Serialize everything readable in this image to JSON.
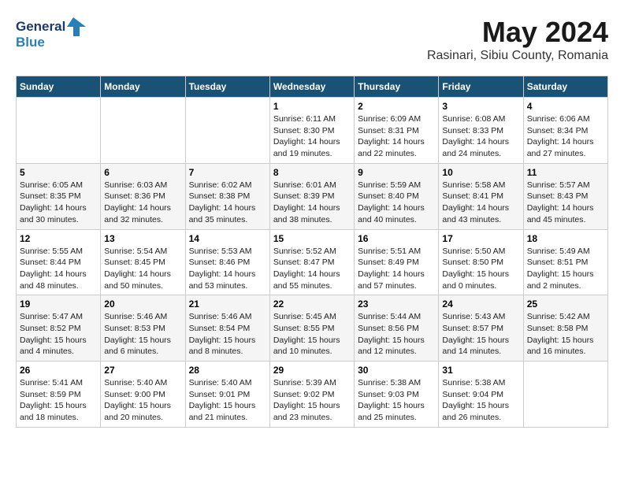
{
  "app": {
    "name": "GeneralBlue",
    "title": "May 2024",
    "subtitle": "Rasinari, Sibiu County, Romania"
  },
  "calendar": {
    "headers": [
      "Sunday",
      "Monday",
      "Tuesday",
      "Wednesday",
      "Thursday",
      "Friday",
      "Saturday"
    ],
    "weeks": [
      [
        {
          "day": "",
          "info": ""
        },
        {
          "day": "",
          "info": ""
        },
        {
          "day": "",
          "info": ""
        },
        {
          "day": "1",
          "info": "Sunrise: 6:11 AM\nSunset: 8:30 PM\nDaylight: 14 hours\nand 19 minutes."
        },
        {
          "day": "2",
          "info": "Sunrise: 6:09 AM\nSunset: 8:31 PM\nDaylight: 14 hours\nand 22 minutes."
        },
        {
          "day": "3",
          "info": "Sunrise: 6:08 AM\nSunset: 8:33 PM\nDaylight: 14 hours\nand 24 minutes."
        },
        {
          "day": "4",
          "info": "Sunrise: 6:06 AM\nSunset: 8:34 PM\nDaylight: 14 hours\nand 27 minutes."
        }
      ],
      [
        {
          "day": "5",
          "info": "Sunrise: 6:05 AM\nSunset: 8:35 PM\nDaylight: 14 hours\nand 30 minutes."
        },
        {
          "day": "6",
          "info": "Sunrise: 6:03 AM\nSunset: 8:36 PM\nDaylight: 14 hours\nand 32 minutes."
        },
        {
          "day": "7",
          "info": "Sunrise: 6:02 AM\nSunset: 8:38 PM\nDaylight: 14 hours\nand 35 minutes."
        },
        {
          "day": "8",
          "info": "Sunrise: 6:01 AM\nSunset: 8:39 PM\nDaylight: 14 hours\nand 38 minutes."
        },
        {
          "day": "9",
          "info": "Sunrise: 5:59 AM\nSunset: 8:40 PM\nDaylight: 14 hours\nand 40 minutes."
        },
        {
          "day": "10",
          "info": "Sunrise: 5:58 AM\nSunset: 8:41 PM\nDaylight: 14 hours\nand 43 minutes."
        },
        {
          "day": "11",
          "info": "Sunrise: 5:57 AM\nSunset: 8:43 PM\nDaylight: 14 hours\nand 45 minutes."
        }
      ],
      [
        {
          "day": "12",
          "info": "Sunrise: 5:55 AM\nSunset: 8:44 PM\nDaylight: 14 hours\nand 48 minutes."
        },
        {
          "day": "13",
          "info": "Sunrise: 5:54 AM\nSunset: 8:45 PM\nDaylight: 14 hours\nand 50 minutes."
        },
        {
          "day": "14",
          "info": "Sunrise: 5:53 AM\nSunset: 8:46 PM\nDaylight: 14 hours\nand 53 minutes."
        },
        {
          "day": "15",
          "info": "Sunrise: 5:52 AM\nSunset: 8:47 PM\nDaylight: 14 hours\nand 55 minutes."
        },
        {
          "day": "16",
          "info": "Sunrise: 5:51 AM\nSunset: 8:49 PM\nDaylight: 14 hours\nand 57 minutes."
        },
        {
          "day": "17",
          "info": "Sunrise: 5:50 AM\nSunset: 8:50 PM\nDaylight: 15 hours\nand 0 minutes."
        },
        {
          "day": "18",
          "info": "Sunrise: 5:49 AM\nSunset: 8:51 PM\nDaylight: 15 hours\nand 2 minutes."
        }
      ],
      [
        {
          "day": "19",
          "info": "Sunrise: 5:47 AM\nSunset: 8:52 PM\nDaylight: 15 hours\nand 4 minutes."
        },
        {
          "day": "20",
          "info": "Sunrise: 5:46 AM\nSunset: 8:53 PM\nDaylight: 15 hours\nand 6 minutes."
        },
        {
          "day": "21",
          "info": "Sunrise: 5:46 AM\nSunset: 8:54 PM\nDaylight: 15 hours\nand 8 minutes."
        },
        {
          "day": "22",
          "info": "Sunrise: 5:45 AM\nSunset: 8:55 PM\nDaylight: 15 hours\nand 10 minutes."
        },
        {
          "day": "23",
          "info": "Sunrise: 5:44 AM\nSunset: 8:56 PM\nDaylight: 15 hours\nand 12 minutes."
        },
        {
          "day": "24",
          "info": "Sunrise: 5:43 AM\nSunset: 8:57 PM\nDaylight: 15 hours\nand 14 minutes."
        },
        {
          "day": "25",
          "info": "Sunrise: 5:42 AM\nSunset: 8:58 PM\nDaylight: 15 hours\nand 16 minutes."
        }
      ],
      [
        {
          "day": "26",
          "info": "Sunrise: 5:41 AM\nSunset: 8:59 PM\nDaylight: 15 hours\nand 18 minutes."
        },
        {
          "day": "27",
          "info": "Sunrise: 5:40 AM\nSunset: 9:00 PM\nDaylight: 15 hours\nand 20 minutes."
        },
        {
          "day": "28",
          "info": "Sunrise: 5:40 AM\nSunset: 9:01 PM\nDaylight: 15 hours\nand 21 minutes."
        },
        {
          "day": "29",
          "info": "Sunrise: 5:39 AM\nSunset: 9:02 PM\nDaylight: 15 hours\nand 23 minutes."
        },
        {
          "day": "30",
          "info": "Sunrise: 5:38 AM\nSunset: 9:03 PM\nDaylight: 15 hours\nand 25 minutes."
        },
        {
          "day": "31",
          "info": "Sunrise: 5:38 AM\nSunset: 9:04 PM\nDaylight: 15 hours\nand 26 minutes."
        },
        {
          "day": "",
          "info": ""
        }
      ]
    ]
  }
}
